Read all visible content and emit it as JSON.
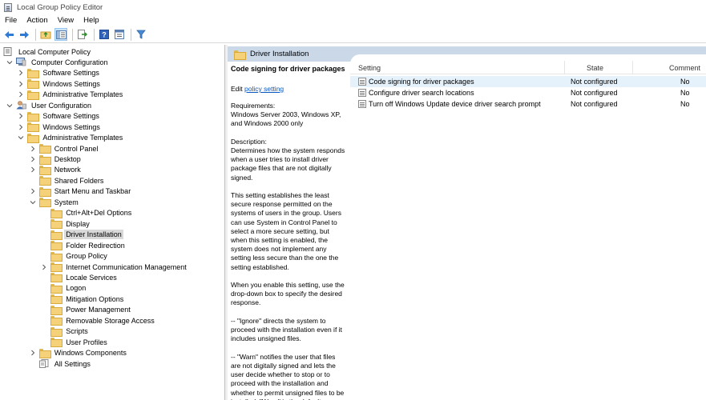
{
  "window": {
    "title": "Local Group Policy Editor"
  },
  "menu": [
    "File",
    "Action",
    "View",
    "Help"
  ],
  "toolbar": {
    "buttons": [
      "back-icon",
      "forward-icon",
      "up-folder-icon",
      "show-hide-tree-icon",
      "export-list-icon",
      "help-icon",
      "properties-icon",
      "filter-icon"
    ]
  },
  "tree": {
    "items": [
      {
        "label": "Local Computer Policy",
        "level": 0,
        "icon": "policy",
        "expander": ""
      },
      {
        "label": "Computer Configuration",
        "level": 1,
        "icon": "computer",
        "expander": "expanded"
      },
      {
        "label": "Software Settings",
        "level": 2,
        "icon": "folder",
        "expander": "collapsed"
      },
      {
        "label": "Windows Settings",
        "level": 2,
        "icon": "folder",
        "expander": "collapsed"
      },
      {
        "label": "Administrative Templates",
        "level": 2,
        "icon": "folder",
        "expander": "collapsed"
      },
      {
        "label": "User Configuration",
        "level": 1,
        "icon": "user",
        "expander": "expanded"
      },
      {
        "label": "Software Settings",
        "level": 2,
        "icon": "folder",
        "expander": "collapsed"
      },
      {
        "label": "Windows Settings",
        "level": 2,
        "icon": "folder",
        "expander": "collapsed"
      },
      {
        "label": "Administrative Templates",
        "level": 2,
        "icon": "folder",
        "expander": "expanded"
      },
      {
        "label": "Control Panel",
        "level": 3,
        "icon": "folder",
        "expander": "collapsed"
      },
      {
        "label": "Desktop",
        "level": 3,
        "icon": "folder",
        "expander": "collapsed"
      },
      {
        "label": "Network",
        "level": 3,
        "icon": "folder",
        "expander": "collapsed"
      },
      {
        "label": "Shared Folders",
        "level": 3,
        "icon": "folder",
        "expander": ""
      },
      {
        "label": "Start Menu and Taskbar",
        "level": 3,
        "icon": "folder",
        "expander": "collapsed"
      },
      {
        "label": "System",
        "level": 3,
        "icon": "folder",
        "expander": "expanded"
      },
      {
        "label": "Ctrl+Alt+Del Options",
        "level": 4,
        "icon": "folder",
        "expander": ""
      },
      {
        "label": "Display",
        "level": 4,
        "icon": "folder",
        "expander": ""
      },
      {
        "label": "Driver Installation",
        "level": 4,
        "icon": "folder",
        "expander": "",
        "selected": true
      },
      {
        "label": "Folder Redirection",
        "level": 4,
        "icon": "folder",
        "expander": ""
      },
      {
        "label": "Group Policy",
        "level": 4,
        "icon": "folder",
        "expander": ""
      },
      {
        "label": "Internet Communication Management",
        "level": 4,
        "icon": "folder",
        "expander": "collapsed"
      },
      {
        "label": "Locale Services",
        "level": 4,
        "icon": "folder",
        "expander": ""
      },
      {
        "label": "Logon",
        "level": 4,
        "icon": "folder",
        "expander": ""
      },
      {
        "label": "Mitigation Options",
        "level": 4,
        "icon": "folder",
        "expander": ""
      },
      {
        "label": "Power Management",
        "level": 4,
        "icon": "folder",
        "expander": ""
      },
      {
        "label": "Removable Storage Access",
        "level": 4,
        "icon": "folder",
        "expander": ""
      },
      {
        "label": "Scripts",
        "level": 4,
        "icon": "folder",
        "expander": ""
      },
      {
        "label": "User Profiles",
        "level": 4,
        "icon": "folder",
        "expander": ""
      },
      {
        "label": "Windows Components",
        "level": 3,
        "icon": "folder",
        "expander": "collapsed"
      },
      {
        "label": "All Settings",
        "level": 3,
        "icon": "settings",
        "expander": ""
      }
    ]
  },
  "breadcrumb": {
    "title": "Driver Installation"
  },
  "extended": {
    "title": "Code signing for driver packages",
    "edit_prefix": "Edit ",
    "edit_link": "policy setting ",
    "body": "Requirements:\nWindows Server 2003, Windows XP, and Windows 2000 only\n\nDescription:\nDetermines how the system responds when a user tries to install driver package files that are not digitally signed.\n\nThis setting establishes the least secure response permitted on the systems of users in the group. Users can use System in Control Panel to select a more secure setting, but when this setting is enabled, the system does not implement any setting less secure than the one the setting established.\n\nWhen you enable this setting, use the drop-down box to specify the desired response.\n\n--   \"Ignore\" directs the system to proceed with the installation even if it includes unsigned files.\n\n--   \"Warn\" notifies the user that files are not digitally signed and lets the user decide whether to stop or to proceed with the installation and whether to permit unsigned files to be installed. \"Warn\" is the default."
  },
  "list": {
    "headers": {
      "setting": "Setting",
      "state": "State",
      "comment": "Comment"
    },
    "rows": [
      {
        "setting": "Code signing for driver packages",
        "state": "Not configured",
        "comment": "No",
        "selected": true
      },
      {
        "setting": "Configure driver search locations",
        "state": "Not configured",
        "comment": "No"
      },
      {
        "setting": "Turn off Windows Update device driver search prompt",
        "state": "Not configured",
        "comment": "No"
      }
    ]
  }
}
